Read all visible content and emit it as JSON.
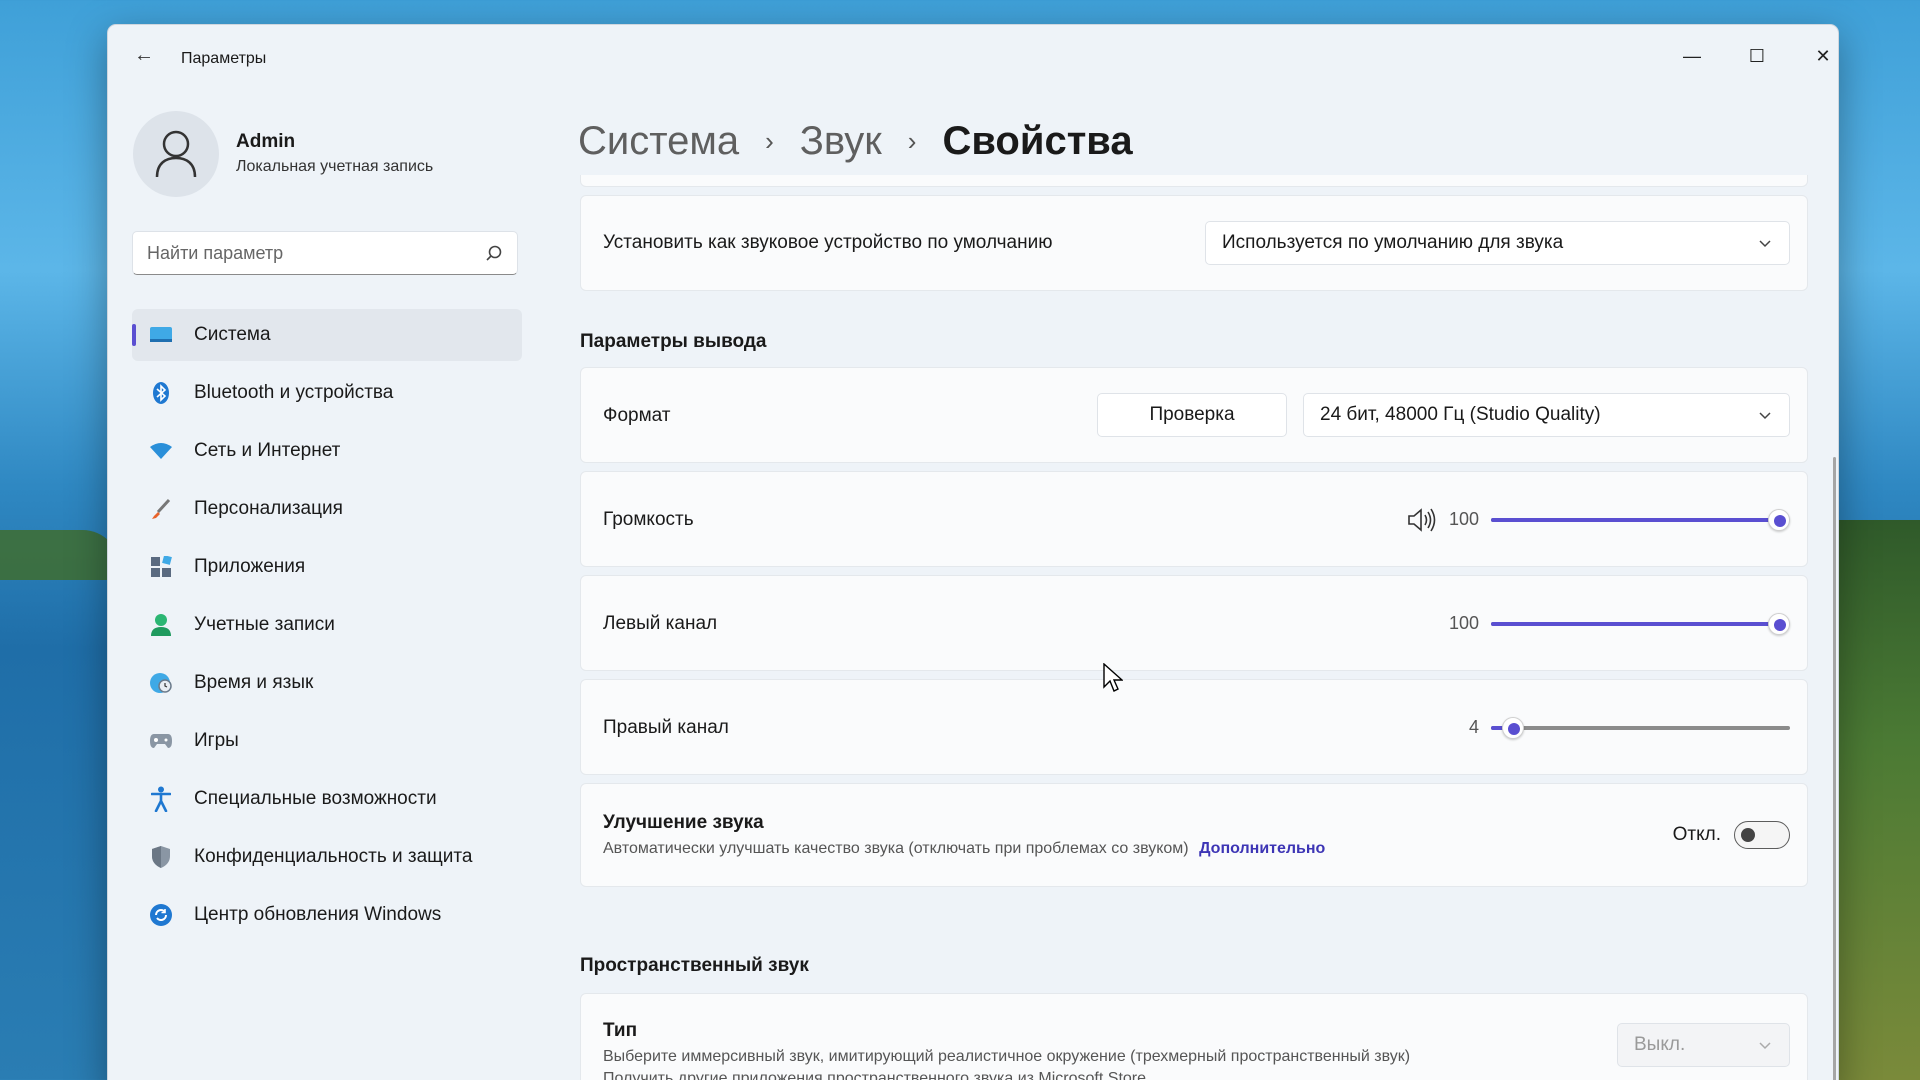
{
  "window": {
    "title": "Параметры",
    "controls": {
      "minimize": "minimize",
      "maximize": "maximize",
      "close": "close"
    }
  },
  "user": {
    "name": "Admin",
    "account_type": "Локальная учетная запись"
  },
  "search": {
    "placeholder": "Найти параметр"
  },
  "sidebar": {
    "items": [
      {
        "label": "Система",
        "icon": "system-icon",
        "active": true
      },
      {
        "label": "Bluetooth и устройства",
        "icon": "bluetooth-icon"
      },
      {
        "label": "Сеть и Интернет",
        "icon": "network-icon"
      },
      {
        "label": "Персонализация",
        "icon": "brush-icon"
      },
      {
        "label": "Приложения",
        "icon": "apps-icon"
      },
      {
        "label": "Учетные записи",
        "icon": "person-icon"
      },
      {
        "label": "Время и язык",
        "icon": "globe-clock-icon"
      },
      {
        "label": "Игры",
        "icon": "gamepad-icon"
      },
      {
        "label": "Специальные возможности",
        "icon": "accessibility-icon"
      },
      {
        "label": "Конфиденциальность и защита",
        "icon": "shield-icon"
      },
      {
        "label": "Центр обновления Windows",
        "icon": "update-icon"
      }
    ]
  },
  "breadcrumb": {
    "item1": "Система",
    "item2": "Звук",
    "current": "Свойства"
  },
  "default_device": {
    "label": "Установить как звуковое устройство по умолчанию",
    "value": "Используется по умолчанию для звука"
  },
  "output": {
    "section_title": "Параметры вывода",
    "format": {
      "label": "Формат",
      "test_button": "Проверка",
      "value": "24 бит, 48000 Гц (Studio Quality)"
    },
    "volume": {
      "label": "Громкость",
      "value": "100",
      "level": 100
    },
    "left_channel": {
      "label": "Левый канал",
      "value": "100",
      "level": 100
    },
    "right_channel": {
      "label": "Правый канал",
      "value": "4",
      "level": 4
    },
    "enhancement": {
      "title": "Улучшение звука",
      "description": "Автоматически улучшать качество звука (отключать при проблемах со звуком)",
      "link": "Дополнительно",
      "state_label": "Откл.",
      "enabled": false
    }
  },
  "spatial": {
    "section_title": "Пространственный звук",
    "type_label": "Тип",
    "type_description": "Выберите иммерсивный звук, имитирующий реалистичное окружение (трехмерный пространственный звук)",
    "type_description2": "Получить другие приложения пространственного звука из Microsoft Store",
    "value": "Выкл."
  },
  "colors": {
    "accent": "#5a4fd1",
    "link": "#3d35b5"
  }
}
